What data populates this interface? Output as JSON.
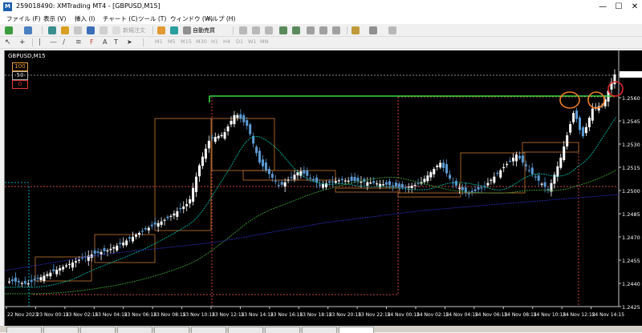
{
  "window": {
    "title": "259018490: XMTrading MT4 - [GBPUSD,M15]",
    "minimize": "—",
    "maximize": "☐",
    "close": "✕"
  },
  "menu": [
    "ファイル (F)",
    "表示 (V)",
    "挿入 (I)",
    "チャート (C)",
    "ツール (T)",
    "ウィンドウ (W)",
    "ヘルプ (H)"
  ],
  "toolbar": {
    "new_order": "新規注文",
    "auto_trading": "自動売買",
    "timeframes": [
      "M1",
      "M5",
      "M15",
      "M30",
      "H1",
      "H4",
      "D1",
      "W1",
      "MN"
    ]
  },
  "chart": {
    "symbol_label": "GBPUSD,M15",
    "fib_levels": [
      "100",
      "50",
      "0"
    ],
    "price_labels": [
      "1.2575",
      "1.2560",
      "1.2545",
      "1.2530",
      "1.2515",
      "1.2500",
      "1.2485",
      "1.2470",
      "1.2455",
      "1.2440",
      "1.2425"
    ],
    "time_labels": [
      "22 Nov 2023",
      "23 Nov 00:15",
      "23 Nov 02:15",
      "23 Nov 04:15",
      "23 Nov 06:15",
      "23 Nov 08:15",
      "23 Nov 10:15",
      "23 Nov 12:15",
      "23 Nov 14:15",
      "23 Nov 16:15",
      "23 Nov 18:15",
      "23 Nov 20:15",
      "23 Nov 22:15",
      "24 Nov 00:15",
      "24 Nov 02:15",
      "24 Nov 04:15",
      "24 Nov 06:15",
      "24 Nov 08:15",
      "24 Nov 10:15",
      "24 Nov 12:15",
      "24 Nov 14:15"
    ],
    "colors": {
      "background": "#000000",
      "bull_candle": "#ffffff",
      "bear_candle": "#5b9bd5",
      "resistance_line": "#32dc46",
      "fast_ma": "#00b4a0",
      "mid_ma": "#3c9b32",
      "slow_ma": "#2a2ab4",
      "boxes": "#c87832",
      "annotation_orange": "#f07d28",
      "annotation_red": "#dc2828"
    }
  }
}
